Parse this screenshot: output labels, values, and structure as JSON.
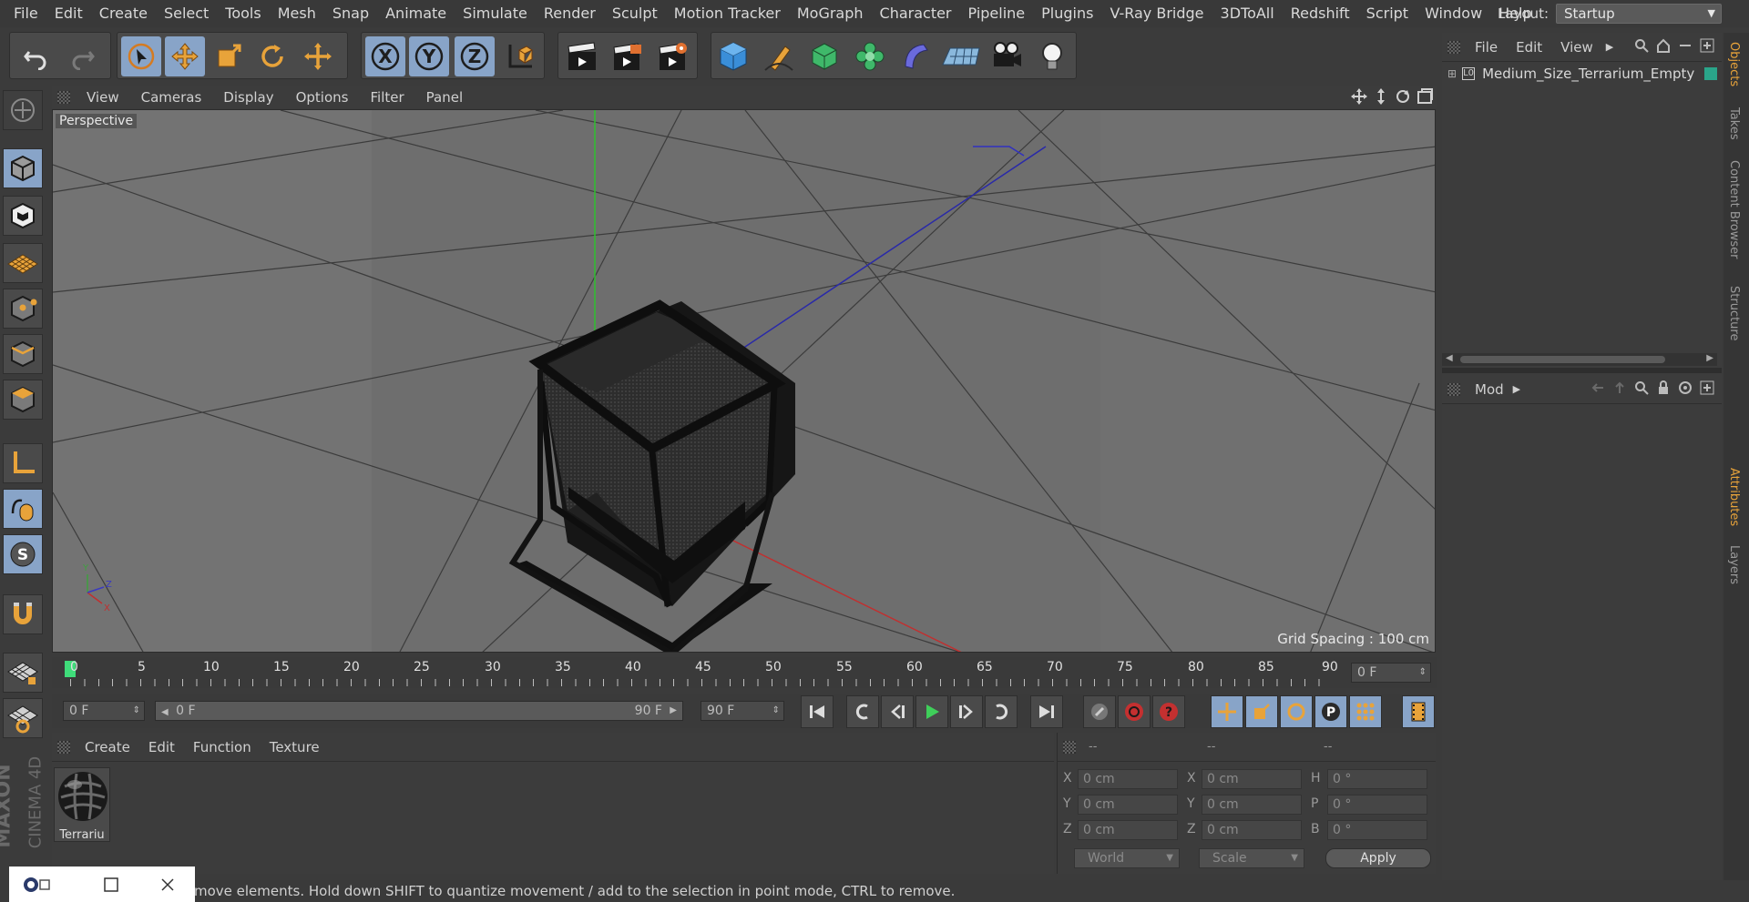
{
  "menubar": {
    "items": [
      "File",
      "Edit",
      "Create",
      "Select",
      "Tools",
      "Mesh",
      "Snap",
      "Animate",
      "Simulate",
      "Render",
      "Sculpt",
      "Motion Tracker",
      "MoGraph",
      "Character",
      "Pipeline",
      "Plugins",
      "V-Ray Bridge",
      "3DToAll",
      "Redshift",
      "Script",
      "Window",
      "Help"
    ],
    "layout_label": "Layout:",
    "layout_value": "Startup"
  },
  "viewport": {
    "menu": [
      "View",
      "Cameras",
      "Display",
      "Options",
      "Filter",
      "Panel"
    ],
    "label": "Perspective",
    "grid_spacing": "Grid Spacing : 100 cm"
  },
  "timeline": {
    "ticks": [
      "0",
      "5",
      "10",
      "15",
      "20",
      "25",
      "30",
      "35",
      "40",
      "45",
      "50",
      "55",
      "60",
      "65",
      "70",
      "75",
      "80",
      "85",
      "90"
    ],
    "current_frame": "0 F"
  },
  "playbar": {
    "start_field": "0 F",
    "range_start": "0 F",
    "range_end": "90 F",
    "end_field": "90 F"
  },
  "material_panel": {
    "menu": [
      "Create",
      "Edit",
      "Function",
      "Texture"
    ],
    "material_name": "Terrariu"
  },
  "coords": {
    "headers": [
      "--",
      "--",
      "--"
    ],
    "rows": [
      {
        "l1": "X",
        "v1": "0 cm",
        "l2": "X",
        "v2": "0 cm",
        "l3": "H",
        "v3": "0 °"
      },
      {
        "l1": "Y",
        "v1": "0 cm",
        "l2": "Y",
        "v2": "0 cm",
        "l3": "P",
        "v3": "0 °"
      },
      {
        "l1": "Z",
        "v1": "0 cm",
        "l2": "Z",
        "v2": "0 cm",
        "l3": "B",
        "v3": "0 °"
      }
    ],
    "world_dropdown": "World",
    "scale_dropdown": "Scale",
    "apply_label": "Apply"
  },
  "objects_panel": {
    "menu": [
      "File",
      "Edit",
      "View"
    ],
    "object_name": "Medium_Size_Terrarium_Empty"
  },
  "attributes_panel": {
    "mode_label": "Mod"
  },
  "side_tabs": [
    "Objects",
    "Takes",
    "Content Browser",
    "Structure",
    "Attributes",
    "Layers"
  ],
  "status": {
    "text": "move elements. Hold down SHIFT to quantize movement / add to the selection in point mode, CTRL to remove."
  },
  "brand": {
    "maxon": "MAXON",
    "product": "CINEMA 4D"
  }
}
